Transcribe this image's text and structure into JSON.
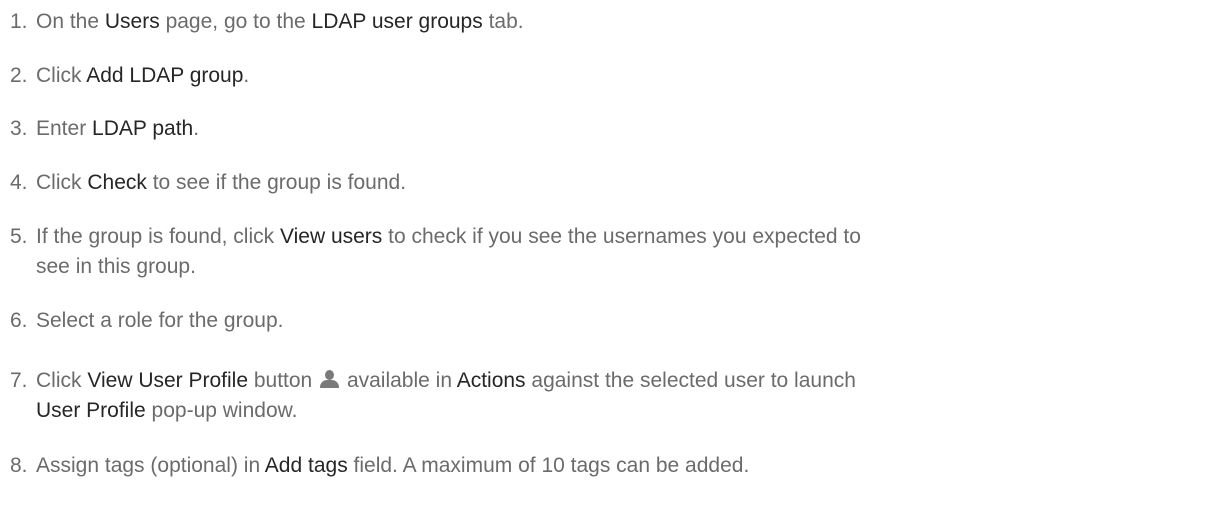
{
  "steps": [
    {
      "num": "1.",
      "line1": [
        {
          "t": "On the ",
          "b": false
        },
        {
          "t": "Users",
          "b": true
        },
        {
          "t": " page, go to the ",
          "b": false
        },
        {
          "t": "LDAP user groups",
          "b": true
        },
        {
          "t": " tab.",
          "b": false
        }
      ]
    },
    {
      "num": "2.",
      "line1": [
        {
          "t": "Click ",
          "b": false
        },
        {
          "t": "Add LDAP group",
          "b": true
        },
        {
          "t": ".",
          "b": false
        }
      ]
    },
    {
      "num": "3.",
      "line1": [
        {
          "t": "Enter ",
          "b": false
        },
        {
          "t": "LDAP path",
          "b": true
        },
        {
          "t": ".",
          "b": false
        }
      ]
    },
    {
      "num": "4.",
      "line1": [
        {
          "t": "Click ",
          "b": false
        },
        {
          "t": "Check",
          "b": true
        },
        {
          "t": " to see if the group is found.",
          "b": false
        }
      ]
    },
    {
      "num": "5.",
      "line1": [
        {
          "t": "If the group is found, click ",
          "b": false
        },
        {
          "t": "View users",
          "b": true
        },
        {
          "t": " to check if you see the usernames you expected to",
          "b": false
        }
      ],
      "line2": [
        {
          "t": "see in this group.",
          "b": false
        }
      ]
    },
    {
      "num": "6.",
      "line1": [
        {
          "t": "Select a role for the group.",
          "b": false
        }
      ]
    },
    {
      "num": "7.",
      "line1a": [
        {
          "t": "Click ",
          "b": false
        },
        {
          "t": "View User Profile",
          "b": true
        },
        {
          "t": " button",
          "b": false
        }
      ],
      "icon": "user-profile-icon",
      "line1b": [
        {
          "t": "available in ",
          "b": false
        },
        {
          "t": "Actions",
          "b": true
        },
        {
          "t": " against the selected user to launch",
          "b": false
        }
      ],
      "line2": [
        {
          "t": "User Profile",
          "b": true
        },
        {
          "t": " pop-up window.",
          "b": false
        }
      ]
    },
    {
      "num": "8.",
      "line1": [
        {
          "t": "Assign tags (optional) in ",
          "b": false
        },
        {
          "t": "Add tags",
          "b": true
        },
        {
          "t": " field. A maximum of 10 tags can be added.",
          "b": false
        }
      ]
    }
  ]
}
